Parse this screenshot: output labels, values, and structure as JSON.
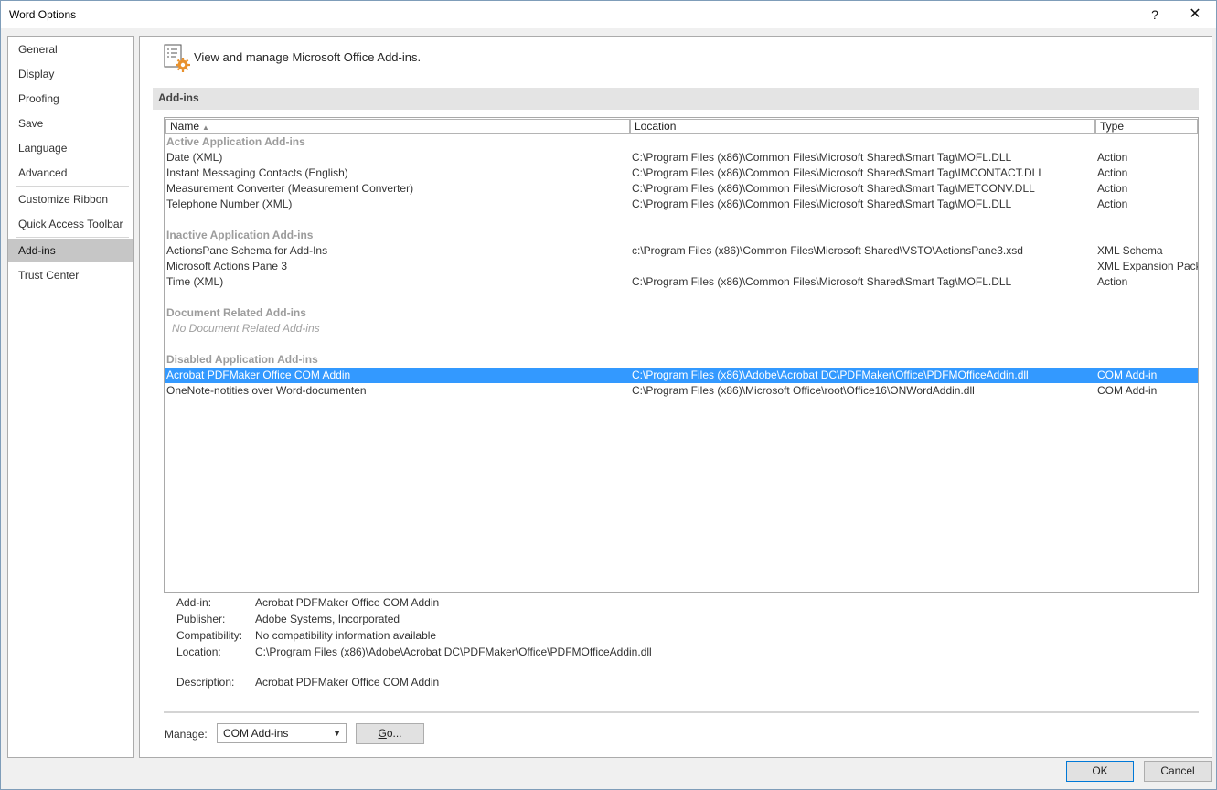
{
  "window": {
    "title": "Word Options",
    "help_glyph": "?",
    "close_glyph": "✕"
  },
  "nav": {
    "items": [
      {
        "label": "General"
      },
      {
        "label": "Display"
      },
      {
        "label": "Proofing"
      },
      {
        "label": "Save"
      },
      {
        "label": "Language"
      },
      {
        "label": "Advanced"
      },
      {
        "label": "Customize Ribbon"
      },
      {
        "label": "Quick Access Toolbar"
      },
      {
        "label": "Add-ins"
      },
      {
        "label": "Trust Center"
      }
    ],
    "active": "Add-ins"
  },
  "header": {
    "text": "View and manage Microsoft Office Add-ins."
  },
  "section": {
    "title": "Add-ins"
  },
  "list": {
    "columns": {
      "name": "Name",
      "location": "Location",
      "type": "Type",
      "sort_glyph": "▲"
    },
    "rows": [
      {
        "kind": "group",
        "name": "Active Application Add-ins",
        "location": "",
        "type": ""
      },
      {
        "kind": "item",
        "name": "Date (XML)",
        "location": "C:\\Program Files (x86)\\Common Files\\Microsoft Shared\\Smart Tag\\MOFL.DLL",
        "type": "Action"
      },
      {
        "kind": "item",
        "name": "Instant Messaging Contacts (English)",
        "location": "C:\\Program Files (x86)\\Common Files\\Microsoft Shared\\Smart Tag\\IMCONTACT.DLL",
        "type": "Action"
      },
      {
        "kind": "item",
        "name": "Measurement Converter (Measurement Converter)",
        "location": "C:\\Program Files (x86)\\Common Files\\Microsoft Shared\\Smart Tag\\METCONV.DLL",
        "type": "Action"
      },
      {
        "kind": "item",
        "name": "Telephone Number (XML)",
        "location": "C:\\Program Files (x86)\\Common Files\\Microsoft Shared\\Smart Tag\\MOFL.DLL",
        "type": "Action"
      },
      {
        "kind": "spacer",
        "name": "",
        "location": "",
        "type": ""
      },
      {
        "kind": "group",
        "name": "Inactive Application Add-ins",
        "location": "",
        "type": ""
      },
      {
        "kind": "item",
        "name": "ActionsPane Schema for Add-Ins",
        "location": "c:\\Program Files (x86)\\Common Files\\Microsoft Shared\\VSTO\\ActionsPane3.xsd",
        "type": "XML Schema"
      },
      {
        "kind": "item",
        "name": "Microsoft Actions Pane 3",
        "location": "",
        "type": "XML Expansion Pack"
      },
      {
        "kind": "item",
        "name": "Time (XML)",
        "location": "C:\\Program Files (x86)\\Common Files\\Microsoft Shared\\Smart Tag\\MOFL.DLL",
        "type": "Action"
      },
      {
        "kind": "spacer",
        "name": "",
        "location": "",
        "type": ""
      },
      {
        "kind": "group",
        "name": "Document Related Add-ins",
        "location": "",
        "type": ""
      },
      {
        "kind": "empty",
        "name": "No Document Related Add-ins",
        "location": "",
        "type": ""
      },
      {
        "kind": "spacer",
        "name": "",
        "location": "",
        "type": ""
      },
      {
        "kind": "group",
        "name": "Disabled Application Add-ins",
        "location": "",
        "type": ""
      },
      {
        "kind": "selected",
        "name": "Acrobat PDFMaker Office COM Addin",
        "location": "C:\\Program Files (x86)\\Adobe\\Acrobat DC\\PDFMaker\\Office\\PDFMOfficeAddin.dll",
        "type": "COM Add-in"
      },
      {
        "kind": "item",
        "name": "OneNote-notities over Word-documenten",
        "location": "C:\\Program Files (x86)\\Microsoft Office\\root\\Office16\\ONWordAddin.dll",
        "type": "COM Add-in"
      }
    ]
  },
  "details": {
    "addin_label": "Add-in:",
    "addin_value": "Acrobat PDFMaker Office COM Addin",
    "publisher_label": "Publisher:",
    "publisher_value": "Adobe Systems, Incorporated",
    "compat_label": "Compatibility:",
    "compat_value": "No compatibility information available",
    "location_label": "Location:",
    "location_value": "C:\\Program Files (x86)\\Adobe\\Acrobat DC\\PDFMaker\\Office\\PDFMOfficeAddin.dll",
    "description_label": "Description:",
    "description_value": "Acrobat PDFMaker Office COM Addin"
  },
  "manage": {
    "label": "Manage:",
    "selected": "COM Add-ins",
    "go_letter": "G",
    "go_rest": "o..."
  },
  "footer": {
    "ok": "OK",
    "cancel": "Cancel"
  }
}
